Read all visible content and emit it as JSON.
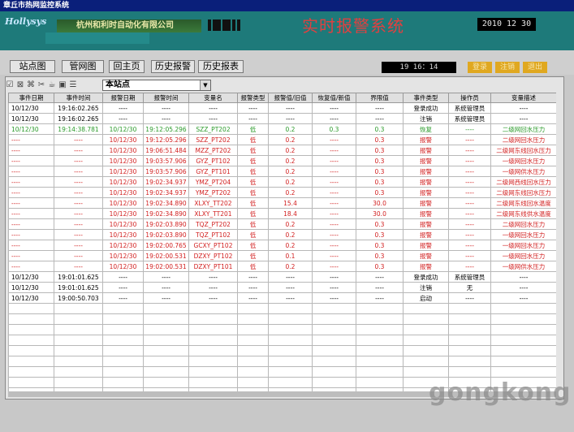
{
  "window_title": "章丘市热网监控系统",
  "header": {
    "logo": "Hollysys",
    "company": "杭州和利时自动化有限公司",
    "system_title": "实时报警系统",
    "date": "2010 12 30"
  },
  "nav": {
    "buttons": [
      "站点图",
      "管网图",
      "回主页",
      "历史报警",
      "历史报表"
    ],
    "clock": "19 16：14",
    "actions": [
      "登录",
      "注销",
      "退出"
    ]
  },
  "filter": {
    "station": "本站点",
    "icons": [
      "checkbox-icon",
      "clear-icon",
      "move-icon",
      "tools-icon",
      "cup-icon",
      "save-icon",
      "list-icon"
    ]
  },
  "table": {
    "columns": [
      "事件日期",
      "事件时间",
      "报警日期",
      "报警时间",
      "变量名",
      "报警类型",
      "报警值/旧值",
      "恢复值/新值",
      "界限值",
      "事件类型",
      "操作员",
      "变量描述"
    ],
    "rows": [
      {
        "c": "k",
        "v": [
          "10/12/30",
          "19:16:02.265",
          "----",
          "----",
          "----",
          "----",
          "----",
          "----",
          "----",
          "登录成功",
          "系统管理员",
          "----"
        ]
      },
      {
        "c": "k",
        "v": [
          "10/12/30",
          "19:16:02.265",
          "----",
          "----",
          "----",
          "----",
          "----",
          "----",
          "----",
          "注销",
          "系统管理员",
          "----"
        ]
      },
      {
        "c": "g",
        "v": [
          "10/12/30",
          "19:14:38.781",
          "10/12/30",
          "19:12:05.296",
          "SZZ_PT202",
          "低",
          "0.2",
          "0.3",
          "0.3",
          "恢复",
          "----",
          "二级网回水压力"
        ]
      },
      {
        "c": "r",
        "v": [
          "----",
          "----",
          "10/12/30",
          "19:12:05.296",
          "SZZ_PT202",
          "低",
          "0.2",
          "----",
          "0.3",
          "报警",
          "----",
          "二级网回水压力"
        ]
      },
      {
        "c": "r",
        "v": [
          "----",
          "----",
          "10/12/30",
          "19:06:51.484",
          "MZZ_PT202",
          "低",
          "0.2",
          "----",
          "0.3",
          "报警",
          "----",
          "二级网东线回水压力"
        ]
      },
      {
        "c": "r",
        "v": [
          "----",
          "----",
          "10/12/30",
          "19:03:57.906",
          "GYZ_PT102",
          "低",
          "0.2",
          "----",
          "0.3",
          "报警",
          "----",
          "一级网回水压力"
        ]
      },
      {
        "c": "r",
        "v": [
          "----",
          "----",
          "10/12/30",
          "19:03:57.906",
          "GYZ_PT101",
          "低",
          "0.2",
          "----",
          "0.3",
          "报警",
          "----",
          "一级网供水压力"
        ]
      },
      {
        "c": "r",
        "v": [
          "----",
          "----",
          "10/12/30",
          "19:02:34.937",
          "YMZ_PT204",
          "低",
          "0.2",
          "----",
          "0.3",
          "报警",
          "----",
          "二级网西线回水压力"
        ]
      },
      {
        "c": "r",
        "v": [
          "----",
          "----",
          "10/12/30",
          "19:02:34.937",
          "YMZ_PT202",
          "低",
          "0.2",
          "----",
          "0.3",
          "报警",
          "----",
          "二级网东线回水压力"
        ]
      },
      {
        "c": "r",
        "v": [
          "----",
          "----",
          "10/12/30",
          "19:02:34.890",
          "XLXY_TT202",
          "低",
          "15.4",
          "----",
          "30.0",
          "报警",
          "----",
          "二级网东线回水温度"
        ]
      },
      {
        "c": "r",
        "v": [
          "----",
          "----",
          "10/12/30",
          "19:02:34.890",
          "XLXY_TT201",
          "低",
          "18.4",
          "----",
          "30.0",
          "报警",
          "----",
          "二级网东线供水温度"
        ]
      },
      {
        "c": "r",
        "v": [
          "----",
          "----",
          "10/12/30",
          "19:02:03.890",
          "TQZ_PT202",
          "低",
          "0.2",
          "----",
          "0.3",
          "报警",
          "----",
          "二级网回水压力"
        ]
      },
      {
        "c": "r",
        "v": [
          "----",
          "----",
          "10/12/30",
          "19:02:03.890",
          "TQZ_PT102",
          "低",
          "0.2",
          "----",
          "0.3",
          "报警",
          "----",
          "一级网回水压力"
        ]
      },
      {
        "c": "r",
        "v": [
          "----",
          "----",
          "10/12/30",
          "19:02:00.765",
          "GCXY_PT102",
          "低",
          "0.2",
          "----",
          "0.3",
          "报警",
          "----",
          "一级网回水压力"
        ]
      },
      {
        "c": "r",
        "v": [
          "----",
          "----",
          "10/12/30",
          "19:02:00.531",
          "DZXY_PT102",
          "低",
          "0.1",
          "----",
          "0.3",
          "报警",
          "----",
          "一级网回水压力"
        ]
      },
      {
        "c": "r",
        "v": [
          "----",
          "----",
          "10/12/30",
          "19:02:00.531",
          "DZXY_PT101",
          "低",
          "0.2",
          "----",
          "0.3",
          "报警",
          "----",
          "一级网供水压力"
        ]
      },
      {
        "c": "k",
        "v": [
          "10/12/30",
          "19:01:01.625",
          "----",
          "----",
          "----",
          "----",
          "----",
          "----",
          "----",
          "登录成功",
          "系统管理员",
          "----"
        ]
      },
      {
        "c": "k",
        "v": [
          "10/12/30",
          "19:01:01.625",
          "----",
          "----",
          "----",
          "----",
          "----",
          "----",
          "----",
          "注销",
          "无",
          "----"
        ]
      },
      {
        "c": "k",
        "v": [
          "10/12/30",
          "19:00:50.703",
          "----",
          "----",
          "----",
          "----",
          "----",
          "----",
          "----",
          "启动",
          "----",
          "----"
        ]
      }
    ],
    "empty_rows": 10
  },
  "watermark": "gongkong"
}
